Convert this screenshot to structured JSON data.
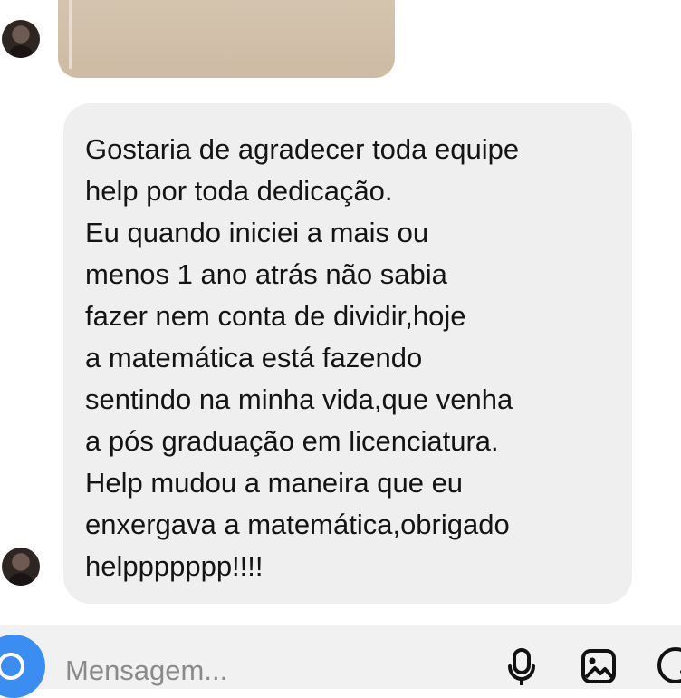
{
  "conversation": {
    "received_photo": {
      "kind": "image"
    },
    "message": {
      "lines": [
        "Gostaria de agradecer toda equipe",
        "help por toda dedicação.",
        "Eu quando iniciei a mais ou",
        "menos 1 ano atrás não sabia",
        "fazer nem conta de dividir,hoje",
        "a matemática está fazendo",
        "sentindo na minha vida,que venha",
        "a pós graduação em licenciatura.",
        "Help mudou a maneira que eu",
        "enxergava a matemática,obrigado",
        "helppppppp!!!!"
      ]
    }
  },
  "composer": {
    "placeholder": "Mensagem...",
    "value": "",
    "camera_icon": "camera-icon",
    "mic_icon": "microphone-icon",
    "gallery_icon": "gallery-icon",
    "sticker_icon": "sticker-icon",
    "accent_color": "#3b8df2"
  }
}
